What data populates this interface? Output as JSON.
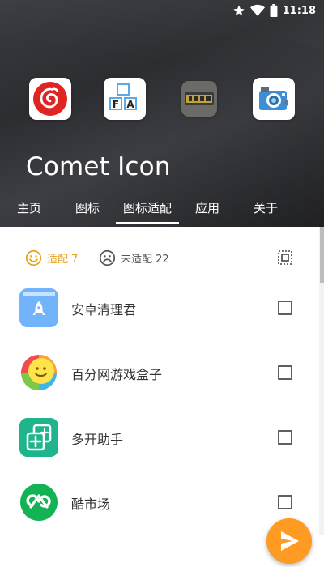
{
  "status_bar": {
    "time": "11:18",
    "icons": [
      "star-icon",
      "wifi-icon",
      "battery-icon"
    ]
  },
  "header": {
    "app_title": "Comet Icon",
    "preview_icons": [
      "netease-music-icon",
      "fa-keyboard-icon",
      "game-emulator-icon",
      "camera-icon"
    ],
    "preview_text": {
      "fa_left": "F",
      "fa_right": "A"
    }
  },
  "tabs": [
    {
      "label": "主页"
    },
    {
      "label": "图标"
    },
    {
      "label": "图标适配",
      "active": true
    },
    {
      "label": "应用"
    },
    {
      "label": "关于"
    }
  ],
  "filters": {
    "adapted": {
      "label": "适配 7",
      "color": "#e6a11d"
    },
    "not_adapted": {
      "label": "未适配 22",
      "color": "#555555"
    }
  },
  "apps": [
    {
      "name": "安卓清理君",
      "icon": "cleaner-rocket-icon",
      "checked": false
    },
    {
      "name": "百分网游戏盒子",
      "icon": "game-box-smile-icon",
      "checked": false
    },
    {
      "name": "多开助手",
      "icon": "multi-open-icon",
      "checked": false
    },
    {
      "name": "酷市场",
      "icon": "coolapk-market-icon",
      "checked": false
    }
  ],
  "colors": {
    "accent": "#ff9a22",
    "header_dark": "#2f3034"
  }
}
